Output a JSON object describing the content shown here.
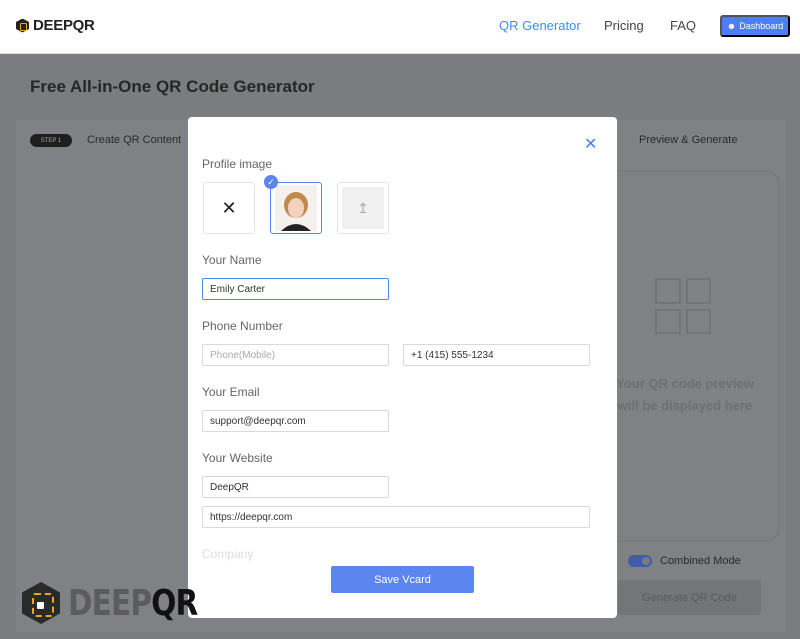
{
  "header": {
    "brand": "DEEPQR",
    "nav": [
      "QR Generator",
      "Pricing",
      "FAQ"
    ],
    "active_nav": "QR Generator",
    "dashboard_label": "Dashboard",
    "accent": "#4a7ff5"
  },
  "page": {
    "title": "Free All-in-One QR Code Generator",
    "step1_badge": "STEP 1",
    "step1_label": "Create QR Content",
    "step2_label": "Preview & Generate",
    "preview_text": [
      "Your QR code preview",
      "will be displayed here"
    ],
    "combined_mode_label": "Combined Mode",
    "combined_mode_on": true,
    "generate_label": "Generate QR Code"
  },
  "modal": {
    "profile_image_label": "Profile image",
    "name_label": "Your Name",
    "name_value": "Emily Carter",
    "phone_label": "Phone Number",
    "phone_mobile_placeholder": "Phone(Mobile)",
    "phone_value": "+1 (415) 555-1234",
    "email_label": "Your Email",
    "email_value": "support@deepqr.com",
    "website_label": "Your Website",
    "website_name_value": "DeepQR",
    "website_url_value": "https://deepqr.com",
    "company_label": "Company",
    "save_label": "Save Vcard"
  },
  "watermark": {
    "brand_a": "DEEP",
    "brand_b": "QR"
  }
}
